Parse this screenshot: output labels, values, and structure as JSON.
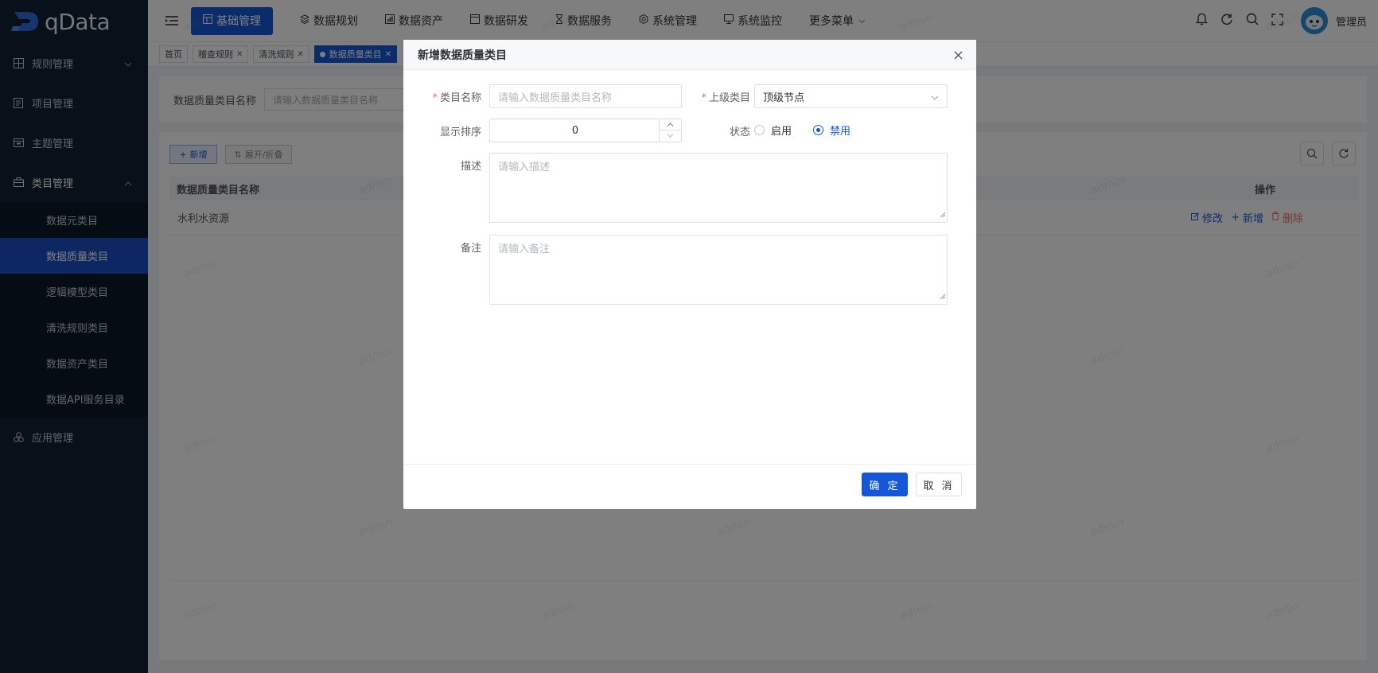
{
  "app": {
    "logo_text": "qData"
  },
  "sidebar": {
    "items": [
      {
        "label": "规则管理",
        "icon": "grid-icon",
        "expanded": false
      },
      {
        "label": "项目管理",
        "icon": "document-icon"
      },
      {
        "label": "主题管理",
        "icon": "calendar-icon"
      },
      {
        "label": "类目管理",
        "icon": "briefcase-icon",
        "expanded": true
      },
      {
        "label": "应用管理",
        "icon": "cluster-icon"
      }
    ],
    "subitems": [
      {
        "label": "数据元类目"
      },
      {
        "label": "数据质量类目",
        "active": true
      },
      {
        "label": "逻辑模型类目"
      },
      {
        "label": "清洗规则类目"
      },
      {
        "label": "数据资产类目"
      },
      {
        "label": "数据API服务目录"
      }
    ]
  },
  "header": {
    "nav": [
      {
        "label": "基础管理",
        "icon": "layout-icon",
        "active": true
      },
      {
        "label": "数据规划",
        "icon": "layers-icon"
      },
      {
        "label": "数据资产",
        "icon": "chart-icon"
      },
      {
        "label": "数据研发",
        "icon": "window-icon"
      },
      {
        "label": "数据服务",
        "icon": "hourglass-icon"
      },
      {
        "label": "系统管理",
        "icon": "gear-icon"
      },
      {
        "label": "系统监控",
        "icon": "monitor-icon"
      },
      {
        "label": "更多菜单",
        "icon": "chevron-down-icon"
      }
    ],
    "username": "管理员"
  },
  "tags": [
    {
      "label": "首页"
    },
    {
      "label": "稽查规则",
      "closable": true
    },
    {
      "label": "清洗规则",
      "closable": true
    },
    {
      "label": "数据质量类目",
      "closable": true,
      "active": true
    }
  ],
  "page": {
    "search_label": "数据质量类目名称",
    "search_placeholder": "请输入数据质量类目名称",
    "add_button": "新增",
    "toggle_button": "展开/折叠",
    "columns": [
      "数据质量类目名称",
      "操作"
    ],
    "rows": [
      {
        "name": "水利水资源",
        "actions": [
          "修改",
          "新增",
          "删除"
        ]
      }
    ],
    "watermark": "admin"
  },
  "dialog": {
    "title": "新增数据质量类目",
    "fields": {
      "name_label": "类目名称",
      "name_placeholder": "请输入数据质量类目名称",
      "parent_label": "上级类目",
      "parent_value": "顶级节点",
      "sort_label": "显示排序",
      "sort_value": "0",
      "status_label": "状态",
      "status_options": [
        "启用",
        "禁用"
      ],
      "status_selected": "禁用",
      "desc_label": "描述",
      "desc_placeholder": "请输入描述",
      "remark_label": "备注",
      "remark_placeholder": "请输入备注"
    },
    "ok_label": "确 定",
    "cancel_label": "取 消"
  },
  "colors": {
    "primary": "#1457d8",
    "sidebar_bg": "#112033",
    "danger": "#f56c6c"
  }
}
